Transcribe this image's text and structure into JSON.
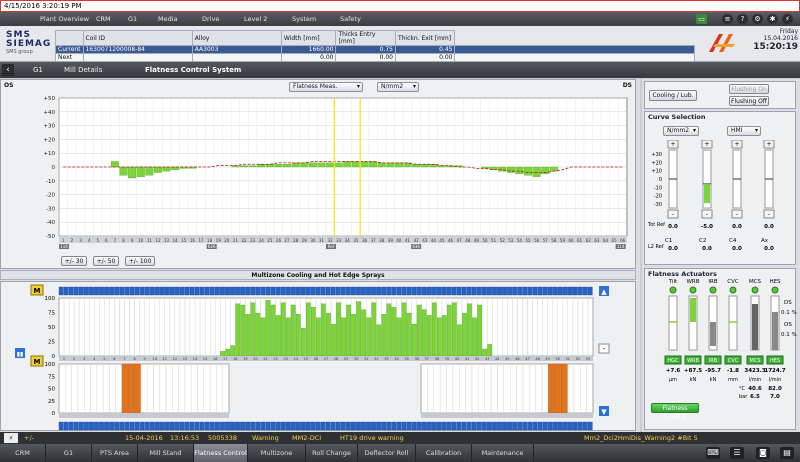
{
  "titlebar": {
    "datetime": "4/15/2016 3:20:19 PM"
  },
  "menu": {
    "items": [
      "Plant Overview",
      "CRM",
      "G1",
      "Media",
      "Drive",
      "Level 2",
      "System",
      "Safety"
    ],
    "toolbar_icons": [
      "menu-icon",
      "help-icon",
      "settings-icon",
      "gear-icon",
      "power-icon",
      "close-icon"
    ]
  },
  "logo": {
    "line1": "SMS",
    "line2": "SIEMAG",
    "line3": "SMS group"
  },
  "coil": {
    "headers": [
      "Coil ID",
      "Alloy",
      "Width [mm]",
      "Thicks Entry [mm]",
      "Thickn. Exit [mm]"
    ],
    "rows": [
      {
        "label": "Current",
        "coil_id": "1630071200008-84",
        "alloy": "AA3003",
        "width": "1660.00",
        "thick_entry": "0.75",
        "thick_exit": "0.45"
      },
      {
        "label": "Next",
        "coil_id": "",
        "alloy": "",
        "width": "0.00",
        "thick_entry": "0.00",
        "thick_exit": "0.00"
      }
    ]
  },
  "datebox": {
    "weekday": "Friday",
    "date": "15.04.2016",
    "time": "15:20:19"
  },
  "breadcrumb": {
    "items": [
      "G1",
      "Mill Details",
      "Flatness Control System"
    ]
  },
  "flatness": {
    "os_label": "OS",
    "ds_label": "DS",
    "meas_select": "Flatness Meas.",
    "unit_select": "N/mm2",
    "y_ticks": [
      "+50",
      "+40",
      "+30",
      "+20",
      "+10",
      "0",
      "-10",
      "-20",
      "-30",
      "-40",
      "-50"
    ],
    "buttons": [
      "+/- 30",
      "+/- 50",
      "+/- 100"
    ],
    "x_marks": [
      "114",
      "626",
      "Ref",
      "636",
      "114"
    ]
  },
  "chart_data": {
    "type": "bar",
    "title": "",
    "ylim": [
      -50,
      50
    ],
    "values": [
      0,
      0,
      0,
      0,
      0,
      0,
      4,
      -6,
      -8,
      -7,
      -6,
      -4,
      -3,
      -2,
      -1,
      -1,
      0,
      0,
      0,
      0,
      1,
      1,
      1,
      2,
      2,
      2,
      2,
      3,
      3,
      3,
      3,
      3,
      3,
      4,
      4,
      4,
      4,
      3,
      3,
      3,
      3,
      2,
      2,
      2,
      1,
      1,
      1,
      0,
      0,
      -1,
      -2,
      -3,
      -4,
      -5,
      -6,
      -7,
      -5,
      -3,
      0,
      0,
      0,
      0,
      0,
      0,
      0,
      0
    ],
    "target": [
      0,
      0,
      0,
      0,
      0,
      0,
      0,
      0,
      0,
      0,
      0,
      0,
      0,
      0,
      0,
      0,
      0,
      0,
      1,
      1,
      1,
      2,
      2,
      2,
      2,
      3,
      3,
      3,
      3,
      4,
      4,
      4,
      4,
      4,
      4,
      4,
      4,
      3,
      3,
      3,
      3,
      2,
      2,
      2,
      1,
      1,
      0,
      0,
      -1,
      -1,
      -2,
      -2,
      -3,
      -3,
      -4,
      -4,
      -4,
      -3,
      -2,
      0,
      0,
      0,
      0,
      0,
      0,
      0
    ],
    "edge_markers": [
      32,
      35
    ]
  },
  "sprays": {
    "title": "Multizone Cooling and Hot Edge Sprays",
    "y_ticks": [
      "100",
      "75",
      "50",
      "25",
      "0"
    ],
    "m_label": "M",
    "cooling_values": [
      0,
      0,
      0,
      0,
      0,
      0,
      0,
      0,
      0,
      0,
      0,
      0,
      0,
      0,
      0,
      0,
      0,
      0,
      0,
      0,
      0,
      0,
      0,
      0,
      0,
      0,
      0,
      0,
      0,
      0,
      0,
      0,
      8,
      12,
      18,
      90,
      88,
      72,
      92,
      74,
      66,
      96,
      88,
      70,
      92,
      66,
      88,
      72,
      48,
      92,
      84,
      66,
      90,
      74,
      55,
      92,
      66,
      88,
      72,
      94,
      80,
      66,
      92,
      54,
      72,
      90,
      84,
      66,
      92,
      74,
      55,
      88,
      80,
      70,
      92,
      66,
      70,
      88,
      92,
      54,
      74,
      90,
      66,
      88,
      12,
      20,
      0,
      0,
      0,
      0,
      0,
      0,
      0,
      0,
      0,
      0,
      0,
      0,
      0,
      0,
      0,
      0,
      0,
      0,
      0,
      0
    ],
    "hes_left": [
      0,
      0,
      0,
      0,
      0,
      0,
      0,
      0,
      0,
      0,
      100,
      100,
      100,
      0,
      0,
      0,
      0,
      0,
      0,
      0,
      0,
      0,
      0,
      0,
      0,
      0,
      0
    ],
    "hes_right": [
      0,
      0,
      0,
      0,
      0,
      0,
      0,
      0,
      0,
      0,
      0,
      0,
      0,
      0,
      0,
      0,
      0,
      0,
      0,
      0,
      100,
      100,
      100,
      0,
      0,
      0,
      0
    ]
  },
  "right": {
    "cooling_btn": "Cooling / Lub.",
    "flushing_on": "Flushing On",
    "flushing_off": "Flushing Off",
    "curve_title": "Curve Selection",
    "curve_unit": "N/mm2",
    "curve_src": "HMI",
    "curve_ticks": [
      "+30",
      "+20",
      "+10",
      "0",
      "-10",
      "-20",
      "-30"
    ],
    "curve_cols": [
      "C1",
      "C2",
      "C4",
      "Ax"
    ],
    "tot_ref": [
      "0.0",
      "-5.0",
      "0.0",
      "0.0"
    ],
    "l2_ref": [
      "0.0",
      "0.0",
      "0.0",
      "0.0"
    ],
    "tot_label": "Tot Ref",
    "l2_label": "L2 Ref",
    "act_title": "Flatness Actuators",
    "act_cols": [
      "Tilt",
      "WRB",
      "IRB",
      "CVC",
      "MCS",
      "HES"
    ],
    "act_modes": [
      "HGC",
      "WRB",
      "IRB",
      "CVC",
      "MCS",
      "HES"
    ],
    "act_values": [
      "+7.6",
      "+87.5",
      "-95.7",
      "-1.8",
      "3423.3",
      "1724.7"
    ],
    "act_units": [
      "µm",
      "kN",
      "kN",
      "mm",
      "l/min",
      "l/min"
    ],
    "act_extra_label": [
      "°C",
      "bar"
    ],
    "act_extra": [
      [
        "40.6",
        "82.0"
      ],
      [
        "6.5",
        "7.0"
      ]
    ],
    "ds_label": "DS",
    "os_label": "OS",
    "ds_pct": "0.1 %",
    "os_pct": "0.1 %",
    "fc_btn": "Flatness Control"
  },
  "status": {
    "icon": "+/-",
    "date": "15-04-2016",
    "time": "13:16:53",
    "code": "5005338",
    "type": "Warning",
    "src": "MM2-DCI",
    "msg": "HT19 drive warning",
    "right": "Mm2_Dci2HmiDis_Warning2 #Bit 5"
  },
  "tabs": [
    "CRM",
    "G1",
    "PTS Area",
    "Mill Stand",
    "Flatness Control",
    "Multizone Cooling",
    "Roll Change",
    "Deflector Roll",
    "Calibration",
    "Maintenance"
  ],
  "active_tab": "Flatness Control"
}
